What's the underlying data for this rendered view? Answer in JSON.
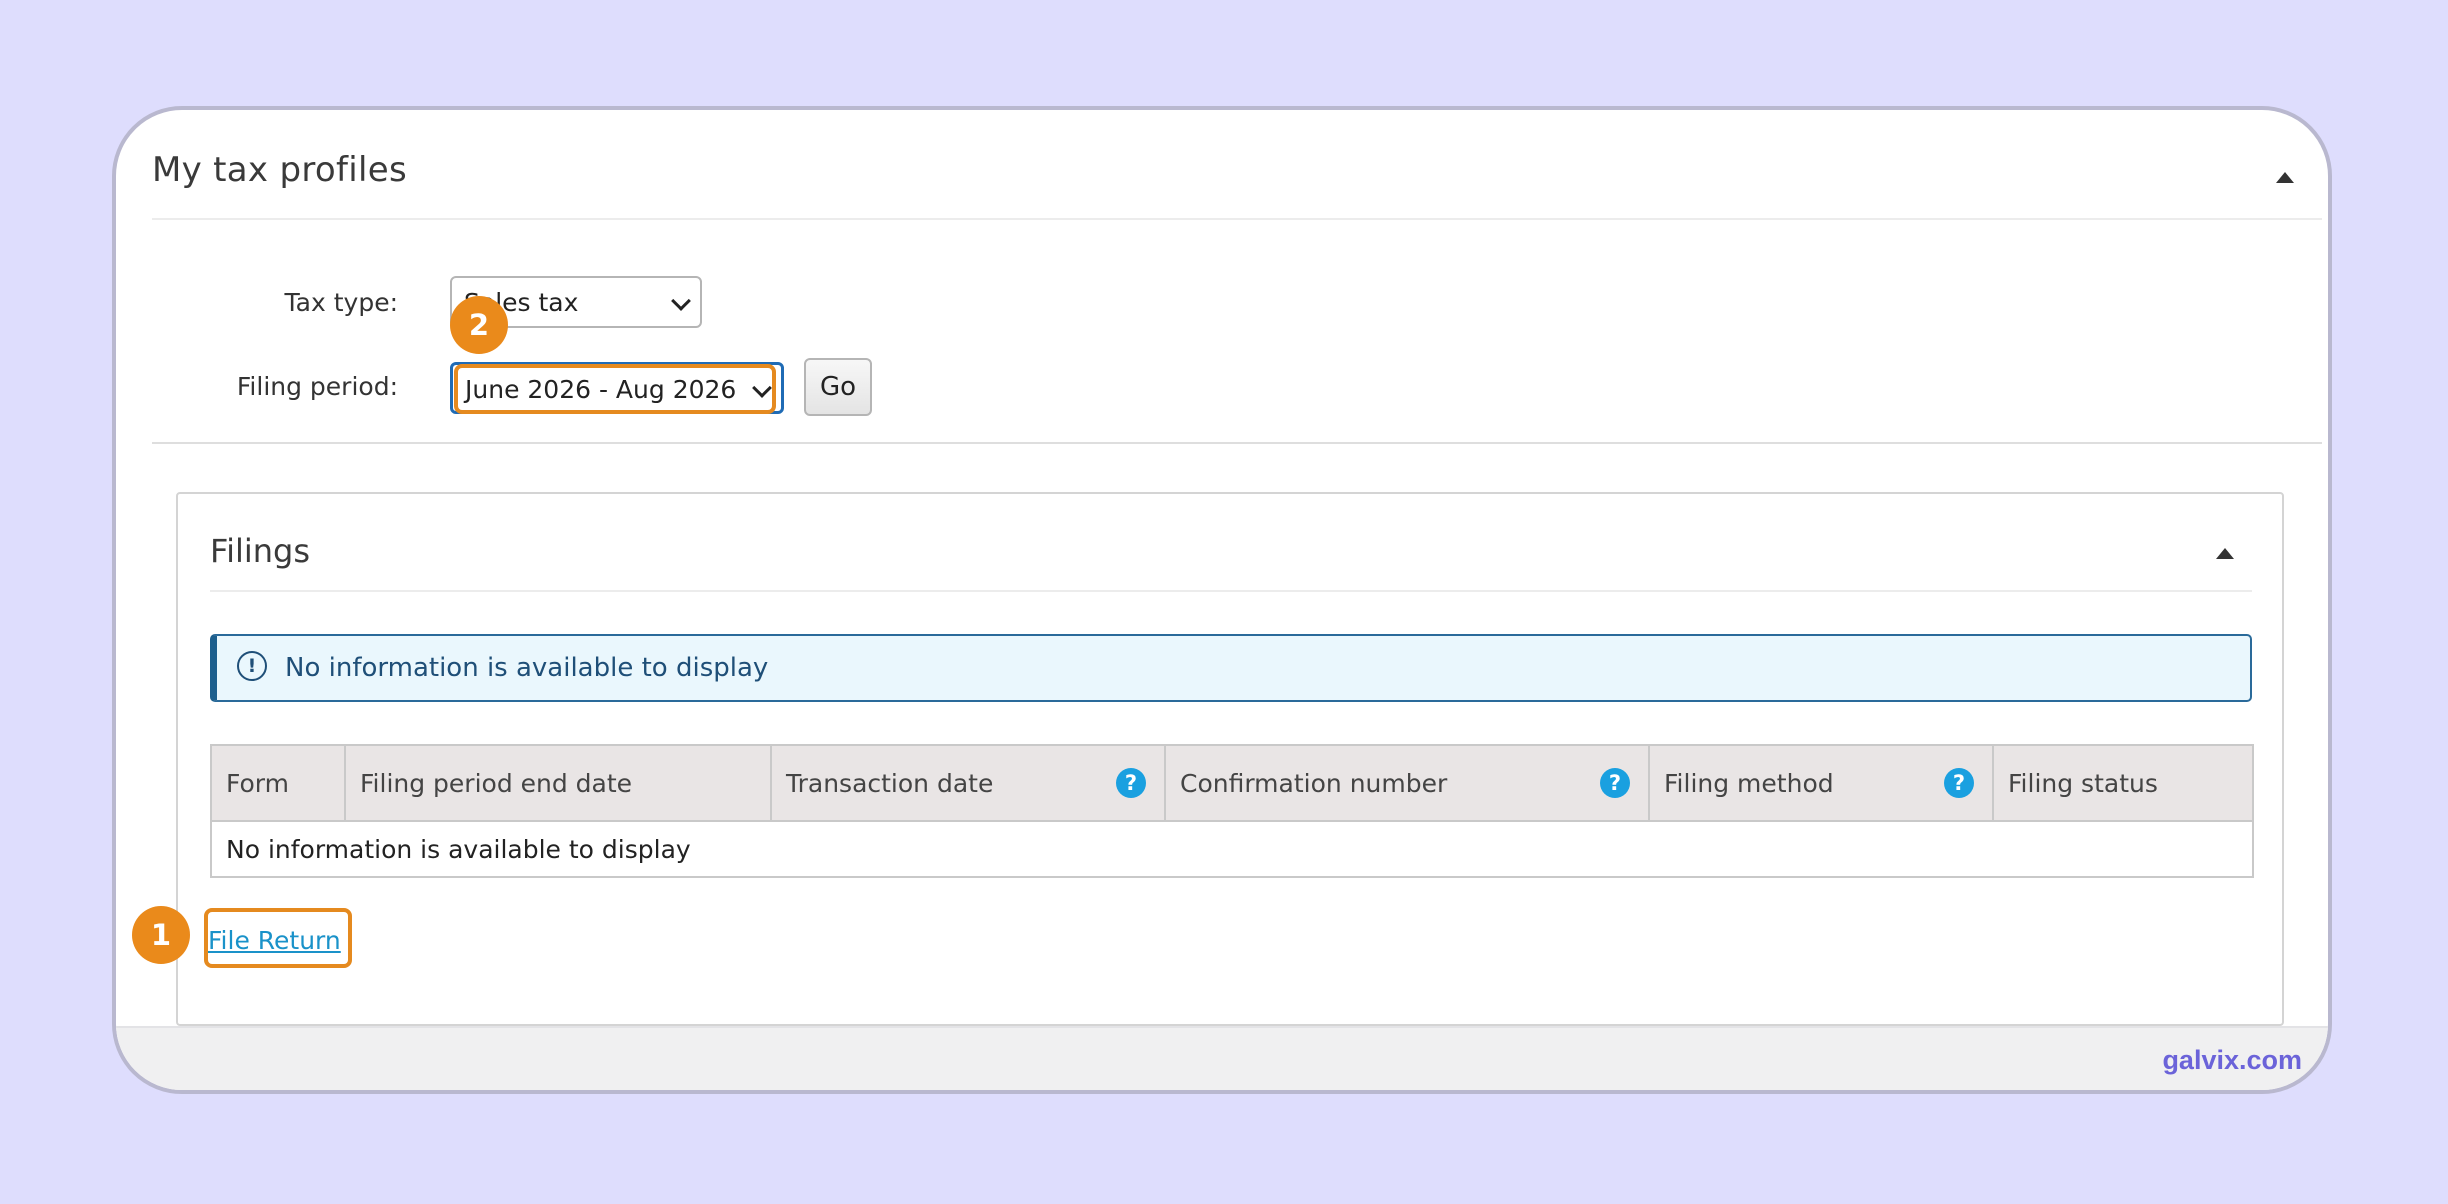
{
  "profile": {
    "title": "My tax profiles",
    "tax_type_label": "Tax type:",
    "tax_type_value": "Sales tax",
    "filing_period_label": "Filing period:",
    "filing_period_value": "June 2026 - Aug 2026",
    "go_label": "Go"
  },
  "filings": {
    "title": "Filings",
    "info_message": "No information is available to display",
    "columns": [
      "Form",
      "Filing period end date",
      "Transaction date",
      "Confirmation number",
      "Filing method",
      "Filing status"
    ],
    "empty_row": "No information is available to display",
    "file_return_label": "File Return"
  },
  "callouts": {
    "step_1": "1",
    "step_2": "2"
  },
  "icons": {
    "info": "info-circle-icon",
    "help": "question-circle-icon",
    "collapse": "caret-up-icon",
    "cursor": "mouse-pointer-icon"
  },
  "colors": {
    "page_background": "#deddfd",
    "accent_orange": "#ea8a1b",
    "link_blue": "#1a92c9",
    "info_border": "#1d5f8d",
    "brand_purple": "#6b63d9"
  },
  "watermark": "galvix.com"
}
